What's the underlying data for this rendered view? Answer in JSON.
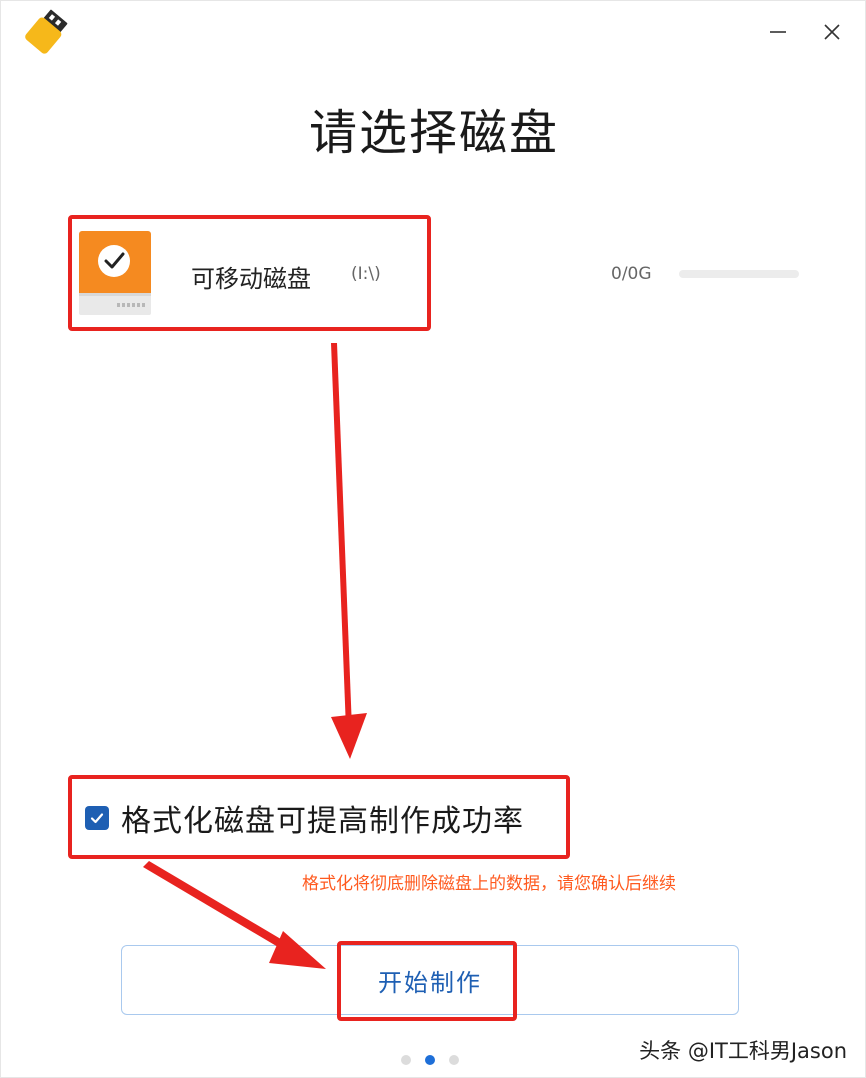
{
  "page": {
    "title": "请选择磁盘"
  },
  "disk": {
    "name": "可移动磁盘",
    "path": "(I:\\)",
    "size": "0/0G",
    "usage_fraction": 0.0,
    "icon": "usb-drive-checked-icon",
    "selected": true
  },
  "format_option": {
    "label": "格式化磁盘可提高制作成功率",
    "checked": true
  },
  "warning": "格式化将彻底删除磁盘上的数据，请您确认后继续",
  "start_button": {
    "label": "开始制作"
  },
  "pager": {
    "count": 3,
    "active_index": 1
  },
  "watermark": "头条 @IT工科男Jason",
  "colors": {
    "accent": "#1e5fb3",
    "highlight": "#e8231f",
    "warning": "#ff5a1f",
    "disk_orange": "#f58a20"
  }
}
